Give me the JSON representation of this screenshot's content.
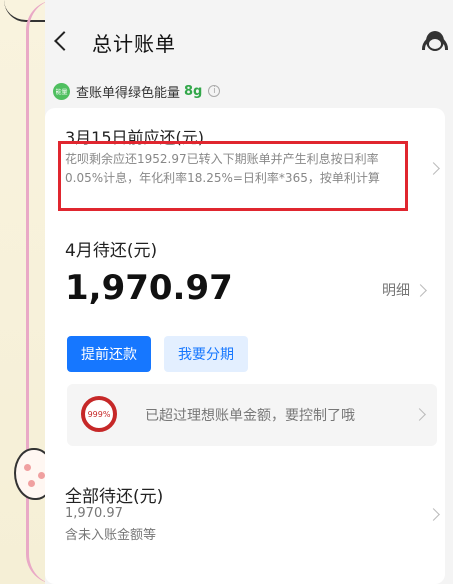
{
  "header": {
    "title": "总计账单"
  },
  "energy": {
    "badge": "能量",
    "text": "查账单得绿色能量",
    "value": "8g",
    "info": "i"
  },
  "due": {
    "label": "3月15日前应还(元)",
    "description": "花呗剩余应还1952.97已转入下期账单并产生利息按日利率0.05%计息，年化利率18.25%=日利率*365，按单利计算"
  },
  "april": {
    "label": "4月待还(元)",
    "amount": "1,970.97",
    "detail_label": "明细"
  },
  "buttons": {
    "prepay": "提前还款",
    "installment": "我要分期"
  },
  "alert": {
    "ring_text": "999%",
    "text": "已超过理想账单金额，要控制了哦"
  },
  "total": {
    "label": "全部待还(元)",
    "value": "1,970.97",
    "note": "含未入账金额等"
  },
  "colors": {
    "accent": "#1677ff",
    "highlight": "#e0262f",
    "energy": "#33a74a"
  }
}
